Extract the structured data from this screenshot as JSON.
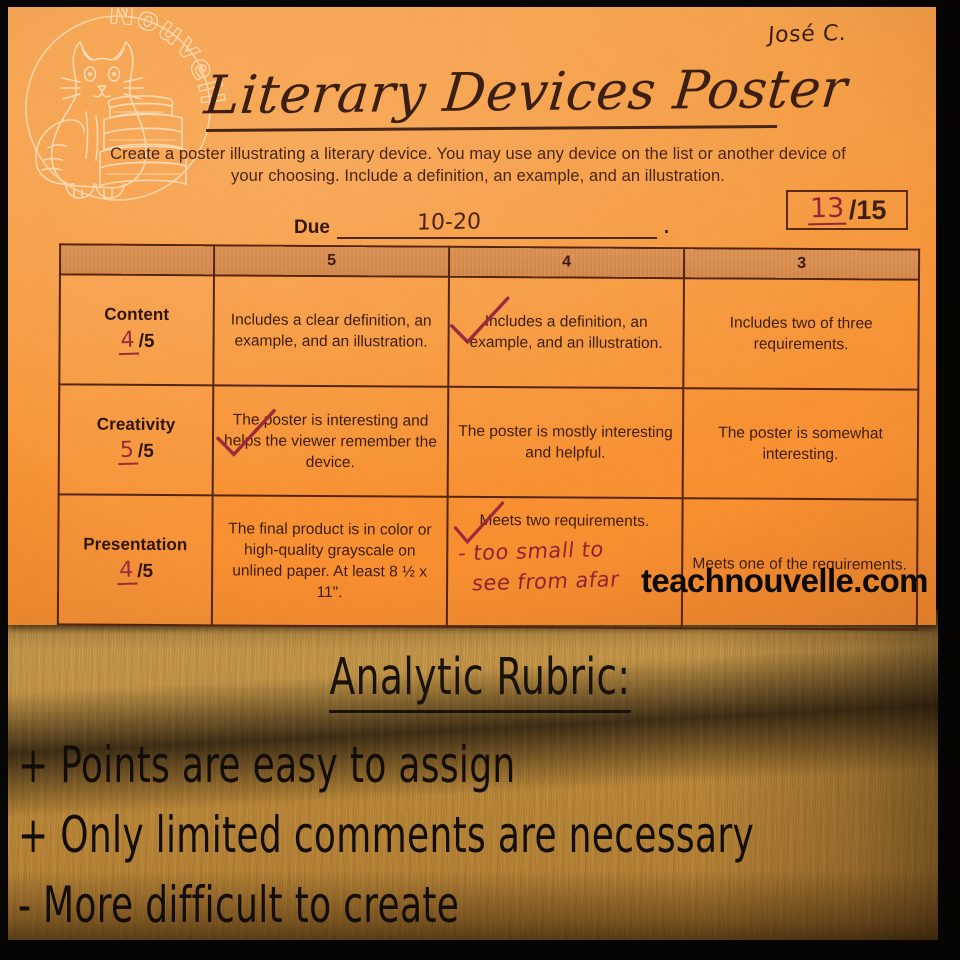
{
  "colors": {
    "paper": "#f89a3e",
    "paper_edge": "#a8521c",
    "wood": "#c59a4d",
    "ink_print": "#3b1f12",
    "ink_hand": "#9b2a3c",
    "table_header": "#d68a4c",
    "frame": "#060504",
    "caption_text": "#120d08"
  },
  "logo": {
    "name": "nouvelle-cat-books-logo",
    "brand_text": "Nouvelle",
    "alt": "outline drawing of a cat seated beside a stack of books inside a circle"
  },
  "worksheet": {
    "student_name": "José C.",
    "title": "Literary Devices Poster",
    "instructions": "Create a poster illustrating a literary device. You may use any device on the list or another device of your choosing. Include a definition, an example, and an illustration.",
    "due_label": "Due",
    "due_value": "10-20",
    "due_period": ".",
    "total_score": {
      "earned": "13",
      "separator": "/",
      "possible": "15"
    },
    "watermark_url": "teachnouvelle.com"
  },
  "rubric": {
    "headers": [
      "",
      "5",
      "4",
      "3"
    ],
    "rows": [
      {
        "criterion": "Content",
        "score_earned": "4",
        "score_possible": "/5",
        "levels": [
          "Includes a clear definition, an example, and an illustration.",
          "Includes a definition, an example, and an illustration.",
          "Includes two of three requirements."
        ],
        "checked_level_index": 1,
        "comment": ""
      },
      {
        "criterion": "Creativity",
        "score_earned": "5",
        "score_possible": "/5",
        "levels": [
          "The poster is interesting and helps the viewer remember the device.",
          "The poster is mostly interesting and helpful.",
          "The poster is somewhat interesting."
        ],
        "checked_level_index": 0,
        "comment": ""
      },
      {
        "criterion": "Presentation",
        "score_earned": "4",
        "score_possible": "/5",
        "levels": [
          "The final product is in color or high-quality grayscale on unlined paper. At least 8 ½ x 11\".",
          "Meets two requirements.",
          "Meets one of the requirements."
        ],
        "checked_level_index": 1,
        "comment_line_1": "- too small to",
        "comment_line_2": "see from afar"
      }
    ]
  },
  "caption": {
    "title": "Analytic Rubric:",
    "bullets": [
      "+ Points are easy to assign",
      "+ Only limited comments are necessary",
      "- More difficult to create"
    ]
  }
}
